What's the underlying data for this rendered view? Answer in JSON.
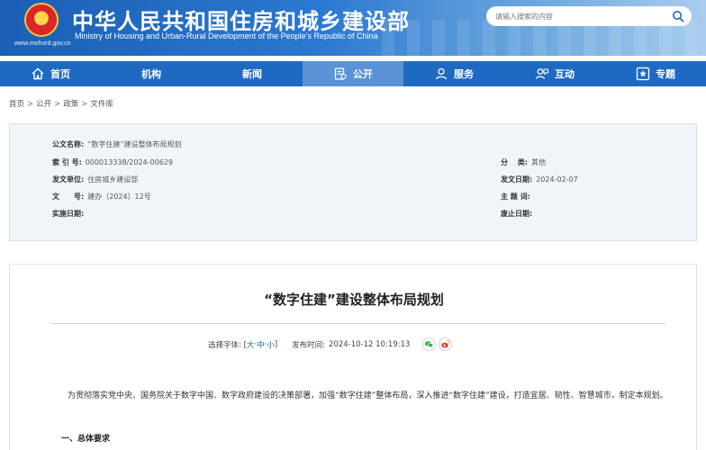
{
  "header": {
    "title": "中华人民共和国住房和城乡建设部",
    "subtitle": "Ministry of Housing and Urban-Rural Development of the People’s Republic of China",
    "site_url": "www.mohurd.gov.cn",
    "emblem_icon": "national-emblem-icon",
    "search": {
      "placeholder": "请输入搜索的内容",
      "icon": "search-icon"
    }
  },
  "nav": {
    "items": [
      {
        "label": "首页",
        "icon": "home-icon"
      },
      {
        "label": "机构",
        "icon": ""
      },
      {
        "label": "新闻",
        "icon": ""
      },
      {
        "label": "公开",
        "icon": "document-icon",
        "active": true
      },
      {
        "label": "服务",
        "icon": "user-service-icon"
      },
      {
        "label": "互动",
        "icon": "chat-user-icon"
      },
      {
        "label": "专题",
        "icon": "star-box-icon"
      }
    ],
    "active_color": "#5a93d6",
    "bar_color": "#1e6ac2"
  },
  "breadcrumb": [
    "首页",
    "公开",
    "政策",
    "文件库"
  ],
  "info": {
    "doc_name_label": "公文名称:",
    "doc_name": "“数字住建”建设整体布局规划",
    "index_no_label": "索 引 号:",
    "index_no": "000013338/2024-00629",
    "category_label": "分　 类:",
    "category": "其他",
    "issuer_label": "发文单位:",
    "issuer": "住房城乡建设部",
    "issue_date_label": "发文日期:",
    "issue_date": "2024-02-07",
    "doc_no_label": "文　　号:",
    "doc_no": "建办〔2024〕12号",
    "subject_label": "主 题 词:",
    "subject": "",
    "effective_label": "实施日期:",
    "effective": "",
    "repeal_label": "废止日期:",
    "repeal": ""
  },
  "article": {
    "title": "“数字住建”建设整体布局规划",
    "font_label": "选择字体: [",
    "font_large": "大",
    "font_medium": "中",
    "font_small": "小",
    "font_close": "]",
    "publish_label": "发布时间:",
    "publish_time": "2024-10-12 10:19:13",
    "share_icons": [
      "wechat-icon",
      "weibo-icon"
    ],
    "paragraph": "为贯彻落实党中央、国务院关于数字中国、数字政府建设的决策部署，加强“数字住建”整体布局，深入推进“数字住建”建设，打造宜居、韧性、智慧城市，制定本规划。",
    "section_heading": "一、总体要求"
  }
}
